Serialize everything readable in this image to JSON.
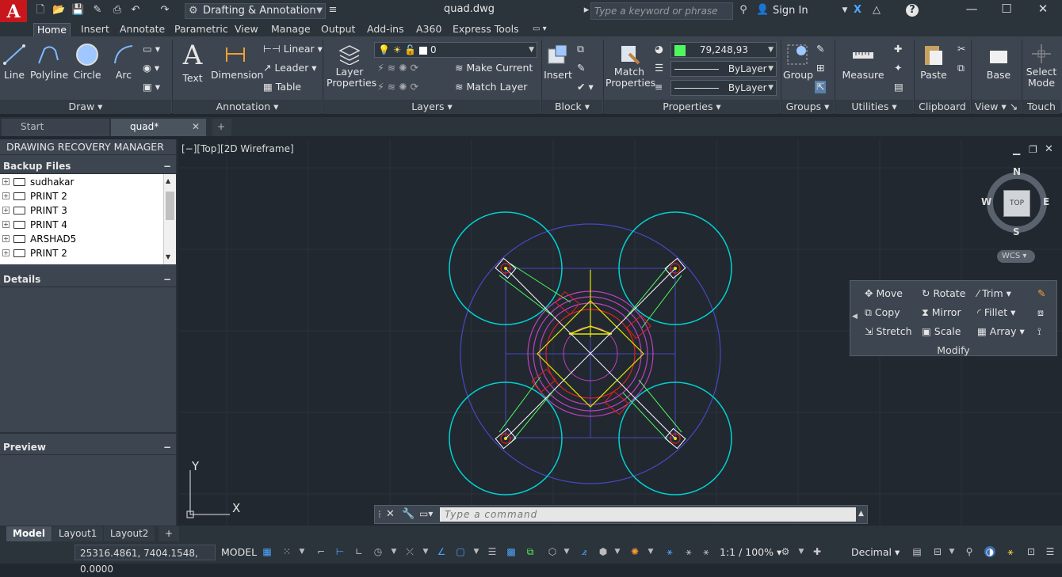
{
  "title_bar": {
    "app_letter": "A",
    "workspace": "Drafting & Annotation",
    "document_title": "quad.dwg",
    "search_placeholder": "Type a keyword or phrase",
    "sign_in": "Sign In"
  },
  "ribbon_tabs": [
    "Home",
    "Insert",
    "Annotate",
    "Parametric",
    "View",
    "Manage",
    "Output",
    "Add-ins",
    "A360",
    "Express Tools"
  ],
  "ribbon": {
    "draw": {
      "title": "Draw",
      "line": "Line",
      "polyline": "Polyline",
      "circle": "Circle",
      "arc": "Arc"
    },
    "annotation": {
      "title": "Annotation",
      "text": "Text",
      "dimension": "Dimension",
      "linear": "Linear",
      "leader": "Leader",
      "table": "Table"
    },
    "layers": {
      "title": "Layers",
      "layer_properties_1": "Layer",
      "layer_properties_2": "Properties",
      "layer_value": "0",
      "make_current": "Make Current",
      "match_layer": "Match Layer"
    },
    "block": {
      "title": "Block",
      "insert": "Insert"
    },
    "properties": {
      "title": "Properties",
      "match_1": "Match",
      "match_2": "Properties",
      "color_value": "79,248,93",
      "linetype": "ByLayer",
      "lineweight": "ByLayer"
    },
    "groups": {
      "title": "Groups",
      "group": "Group"
    },
    "utilities": {
      "title": "Utilities",
      "measure": "Measure"
    },
    "clipboard": {
      "title": "Clipboard",
      "paste": "Paste"
    },
    "view": {
      "title": "View",
      "base": "Base"
    },
    "touch": {
      "title": "Touch",
      "select_1": "Select",
      "select_2": "Mode"
    }
  },
  "doc_tabs": [
    {
      "label": "Start"
    },
    {
      "label": "quad*"
    }
  ],
  "palette": {
    "title": "DRAWING RECOVERY MANAGER",
    "backup_header": "Backup Files",
    "backup_items": [
      "sudhakar",
      "PRINT 2",
      "PRINT 3",
      "PRINT 4",
      "ARSHAD5",
      "PRINT 2"
    ],
    "details_header": "Details",
    "preview_header": "Preview"
  },
  "viewport": {
    "label": "[−][Top][2D Wireframe]",
    "compass_n": "N",
    "compass_s": "S",
    "compass_e": "E",
    "compass_w": "W",
    "cube_label": "TOP",
    "wcs": "WCS",
    "ucs_x": "X",
    "ucs_y": "Y"
  },
  "modify_panel": {
    "title": "Modify",
    "move": "Move",
    "rotate": "Rotate",
    "trim": "Trim",
    "copy": "Copy",
    "mirror": "Mirror",
    "fillet": "Fillet",
    "stretch": "Stretch",
    "scale": "Scale",
    "array": "Array"
  },
  "command_line": {
    "placeholder": "Type a command"
  },
  "layout_tabs": [
    "Model",
    "Layout1",
    "Layout2"
  ],
  "status_bar": {
    "coordinates": "25316.4861, 7404.1548, 0.0000",
    "model": "MODEL",
    "scale": "1:1 / 100%",
    "units": "Decimal"
  },
  "colors": {
    "cyan": "#00d2d2",
    "magenta": "#c040c0",
    "red": "#e02020",
    "green": "#4ff85d",
    "yellow": "#e6e600",
    "blue": "#4040c0"
  }
}
